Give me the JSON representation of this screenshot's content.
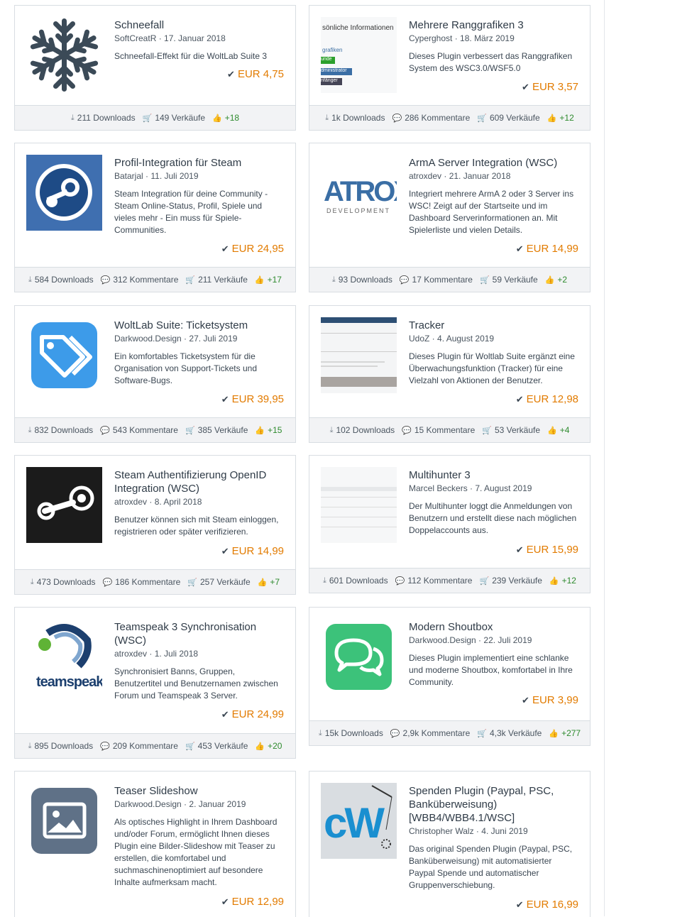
{
  "cards": [
    {
      "title": "Schneefall",
      "author": "SoftCreatR",
      "date": "17. Januar 2018",
      "desc": "Schneefall-Effekt für die WoltLab Suite 3",
      "price": "EUR 4,75",
      "downloads": "211 Downloads",
      "comments": "",
      "sales": "149 Verkäufe",
      "likes": "+18",
      "thumb": "snowflake-icon"
    },
    {
      "title": "Mehrere Ranggrafiken 3",
      "author": "Cyperghost",
      "date": "18. März 2019",
      "desc": "Dieses Plugin verbessert das Ranggrafiken System des WSC3.0/WSF5.0",
      "price": "EUR 3,57",
      "downloads": "1k Downloads",
      "comments": "286 Kommentare",
      "sales": "609 Verkäufe",
      "likes": "+12",
      "thumb": "rank-screenshot",
      "thumb_texts": [
        "sönliche Informationen",
        "grafiken",
        "unde",
        "dministrator",
        "nfänger"
      ]
    },
    {
      "title": "Profil-Integration für Steam",
      "author": "Batarjal",
      "date": "11. Juli 2019",
      "desc": "Steam Integration für deine Community - Steam Online-Status, Profil, Spiele und vieles mehr - Ein muss für Spiele-Communities.",
      "price": "EUR 24,95",
      "downloads": "584 Downloads",
      "comments": "312 Kommentare",
      "sales": "211 Verkäufe",
      "likes": "+17",
      "thumb": "steam-logo"
    },
    {
      "title": "ArmA Server Integration (WSC)",
      "author": "atroxdev",
      "date": "21. Januar 2018",
      "desc": "Integriert mehrere ArmA 2 oder 3 Server ins WSC! Zeigt auf der Startseite und im Dashboard Serverinformationen an. Mit Spielerliste und vielen Details.",
      "price": "EUR 14,99",
      "downloads": "93 Downloads",
      "comments": "17 Kommentare",
      "sales": "59 Verkäufe",
      "likes": "+2",
      "thumb": "atrox-logo",
      "thumb_texts": [
        "ATROX",
        "DEVELOPMENT"
      ]
    },
    {
      "title": "WoltLab Suite: Ticketsystem",
      "author": "Darkwood.Design",
      "date": "27. Juli 2019",
      "desc": "Ein komfortables Ticketsystem für die Organisation von Support-Tickets und Software-Bugs.",
      "price": "EUR 39,95",
      "downloads": "832 Downloads",
      "comments": "543 Kommentare",
      "sales": "385 Verkäufe",
      "likes": "+15",
      "thumb": "tag-icon"
    },
    {
      "title": "Tracker",
      "author": "UdoZ",
      "date": "4. August 2019",
      "desc": "Dieses Plugin für Woltlab Suite ergänzt eine Überwachungsfunktion (Tracker) für eine Vielzahl von Aktionen der Benutzer.",
      "price": "EUR 12,98",
      "downloads": "102 Downloads",
      "comments": "15 Kommentare",
      "sales": "53 Verkäufe",
      "likes": "+4",
      "thumb": "tracker-screenshot"
    },
    {
      "title": "Steam Authentifizierung OpenID Integration (WSC)",
      "author": "atroxdev",
      "date": "8. April 2018",
      "desc": "Benutzer können sich mit Steam einloggen, registrieren oder später verifizieren.",
      "price": "EUR 14,99",
      "downloads": "473 Downloads",
      "comments": "186 Kommentare",
      "sales": "257 Verkäufe",
      "likes": "+7",
      "thumb": "steam-dark-logo"
    },
    {
      "title": "Multihunter 3",
      "author": "Marcel Beckers",
      "date": "7. August 2019",
      "desc": "Der Multihunter loggt die Anmeldungen von Benutzern und erstellt diese nach möglichen Doppelaccounts aus.",
      "price": "EUR 15,99",
      "downloads": "601 Downloads",
      "comments": "112 Kommentare",
      "sales": "239 Verkäufe",
      "likes": "+12",
      "thumb": "multihunter-screenshot"
    },
    {
      "title": "Teamspeak 3 Synchronisation (WSC)",
      "author": "atroxdev",
      "date": "1. Juli 2018",
      "desc": "Synchronisiert Banns, Gruppen, Benutzertitel und Benutzernamen zwischen Forum und Teamspeak 3 Server.",
      "price": "EUR 24,99",
      "downloads": "895 Downloads",
      "comments": "209 Kommentare",
      "sales": "453 Verkäufe",
      "likes": "+20",
      "thumb": "teamspeak-logo",
      "thumb_texts": [
        "teamspeak"
      ]
    },
    {
      "title": "Modern Shoutbox",
      "author": "Darkwood.Design",
      "date": "22. Juli 2019",
      "desc": "Dieses Plugin implementiert eine schlanke und moderne Shoutbox, komfortabel in Ihre Community.",
      "price": "EUR 3,99",
      "downloads": "15k Downloads",
      "comments": "2,9k Kommentare",
      "sales": "4,3k Verkäufe",
      "likes": "+277",
      "thumb": "chat-icon"
    },
    {
      "title": "Teaser Slideshow",
      "author": "Darkwood.Design",
      "date": "2. Januar 2019",
      "desc": "Als optisches Highlight in Ihrem Dashboard und/oder Forum, ermöglicht Ihnen dieses Plugin eine Bilder-Slideshow mit Teaser zu erstellen, die komfortabel und suchmaschinenoptimiert auf besondere Inhalte aufmerksam macht.",
      "price": "EUR 12,99",
      "downloads": "",
      "comments": "",
      "sales": "",
      "likes": "",
      "thumb": "image-icon"
    },
    {
      "title": "Spenden Plugin (Paypal, PSC, Banküberweisung) [WBB4/WBB4.1/WSC]",
      "author": "Christopher Walz",
      "date": "4. Juni 2019",
      "desc": "Das original Spenden Plugin (Paypal, PSC, Banküberweisung) mit automatisierter Paypal Spende und automatischer Gruppenverschiebung.",
      "price": "EUR 16,99",
      "downloads": "",
      "comments": "",
      "sales": "",
      "likes": "",
      "thumb": "cw-logo",
      "thumb_texts": [
        "cW"
      ]
    }
  ]
}
